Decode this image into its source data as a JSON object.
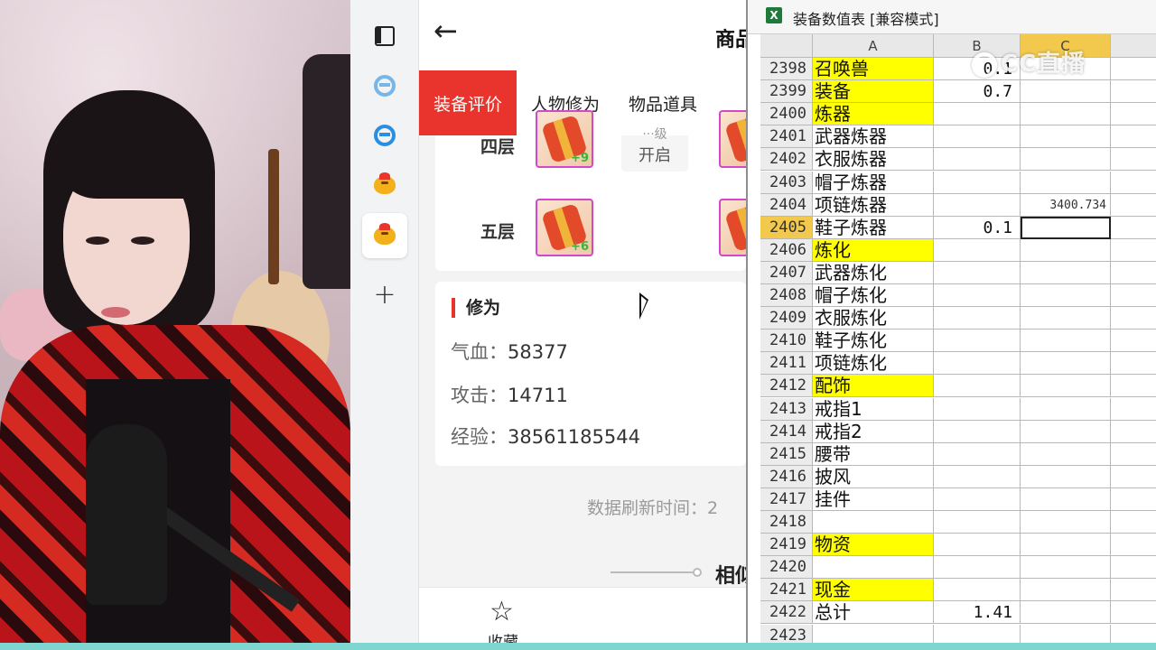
{
  "app": {
    "back_icon": "arrow-left-icon",
    "title": "商品",
    "tabs": [
      {
        "label": "装备评价",
        "active": true
      },
      {
        "label": "人物修为",
        "active": false
      },
      {
        "label": "物品道具",
        "active": false
      }
    ],
    "floors": [
      {
        "label": "四层",
        "level": "+9",
        "status_top": "···级",
        "status": "开启"
      },
      {
        "label": "五层",
        "level": "+6"
      }
    ],
    "cultivation": {
      "title": "修为",
      "stats": [
        {
          "key": "气血：",
          "value": "58377"
        },
        {
          "key": "攻击：",
          "value": "14711"
        },
        {
          "key": "经验：",
          "value": "38561185544"
        }
      ]
    },
    "refresh_text": "数据刷新时间：2",
    "similar_title": "相似",
    "favorite_label": "收藏",
    "accent_color": "#e8342c"
  },
  "sidebar": {
    "icons": [
      "panel-icon",
      "edge-dev-icon",
      "edge-icon",
      "bird-app-icon",
      "bird-app-icon-active",
      "plus-icon"
    ]
  },
  "excel": {
    "title": "装备数值表  [兼容模式]",
    "columns": [
      "A",
      "B",
      "C"
    ],
    "rows": [
      {
        "n": "2398",
        "a": "召唤兽",
        "y": true,
        "b": "0.1",
        "c": ""
      },
      {
        "n": "2399",
        "a": "装备",
        "y": true,
        "b": "0.7",
        "c": ""
      },
      {
        "n": "2400",
        "a": "炼器",
        "y": true,
        "b": "",
        "c": ""
      },
      {
        "n": "2401",
        "a": "武器炼器",
        "y": false,
        "b": "",
        "c": ""
      },
      {
        "n": "2402",
        "a": "衣服炼器",
        "y": false,
        "b": "",
        "c": ""
      },
      {
        "n": "2403",
        "a": "帽子炼器",
        "y": false,
        "b": "",
        "c": ""
      },
      {
        "n": "2404",
        "a": "项链炼器",
        "y": false,
        "b": "",
        "c": "3400.734"
      },
      {
        "n": "2405",
        "a": "鞋子炼器",
        "y": false,
        "b": "0.1",
        "c": "",
        "sel": true
      },
      {
        "n": "2406",
        "a": "炼化",
        "y": true,
        "b": "",
        "c": ""
      },
      {
        "n": "2407",
        "a": "武器炼化",
        "y": false,
        "b": "",
        "c": ""
      },
      {
        "n": "2408",
        "a": "帽子炼化",
        "y": false,
        "b": "",
        "c": ""
      },
      {
        "n": "2409",
        "a": "衣服炼化",
        "y": false,
        "b": "",
        "c": ""
      },
      {
        "n": "2410",
        "a": "鞋子炼化",
        "y": false,
        "b": "",
        "c": ""
      },
      {
        "n": "2411",
        "a": "项链炼化",
        "y": false,
        "b": "",
        "c": ""
      },
      {
        "n": "2412",
        "a": "配饰",
        "y": true,
        "b": "",
        "c": ""
      },
      {
        "n": "2413",
        "a": "戒指1",
        "y": false,
        "b": "",
        "c": ""
      },
      {
        "n": "2414",
        "a": "戒指2",
        "y": false,
        "b": "",
        "c": ""
      },
      {
        "n": "2415",
        "a": "腰带",
        "y": false,
        "b": "",
        "c": ""
      },
      {
        "n": "2416",
        "a": "披风",
        "y": false,
        "b": "",
        "c": ""
      },
      {
        "n": "2417",
        "a": "挂件",
        "y": false,
        "b": "",
        "c": ""
      },
      {
        "n": "2418",
        "a": "",
        "y": false,
        "b": "",
        "c": ""
      },
      {
        "n": "2419",
        "a": "物资",
        "y": true,
        "b": "",
        "c": ""
      },
      {
        "n": "2420",
        "a": "",
        "y": false,
        "b": "",
        "c": ""
      },
      {
        "n": "2421",
        "a": "现金",
        "y": true,
        "b": "",
        "c": ""
      },
      {
        "n": "2422",
        "a": "总计",
        "y": false,
        "b": "1.41",
        "c": ""
      },
      {
        "n": "2423",
        "a": "",
        "y": false,
        "b": "",
        "c": ""
      }
    ],
    "highlight_color": "#ffff00"
  },
  "watermark": "CC直播"
}
